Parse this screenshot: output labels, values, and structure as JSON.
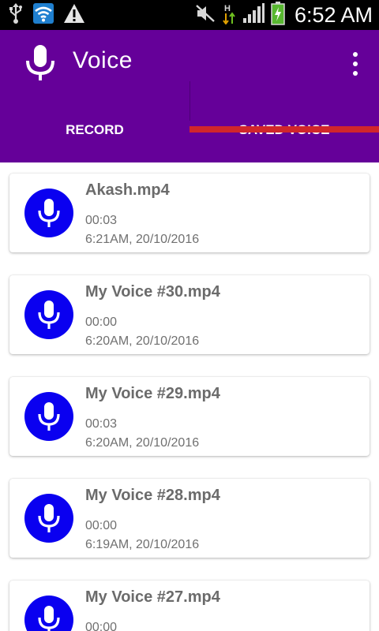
{
  "status_bar": {
    "time": "6:52 AM",
    "icons": [
      "usb-icon",
      "wifi-icon",
      "warning-icon",
      "mute-icon",
      "hsdpa-data-icon",
      "signal-icon",
      "battery-charging-icon"
    ]
  },
  "app_bar": {
    "title": "Voice",
    "icon": "microphone-icon",
    "menu_icon": "more-vert-icon",
    "color": "#650099"
  },
  "tabs": [
    {
      "label": "RECORD",
      "active": false
    },
    {
      "label": "SAVED VOICE",
      "active": true
    }
  ],
  "tab_indicator_color": "#d1262b",
  "recordings": [
    {
      "name": "Akash.mp4",
      "duration": "00:03",
      "date": "6:21AM, 20/10/2016"
    },
    {
      "name": "My Voice #30.mp4",
      "duration": "00:00",
      "date": "6:20AM, 20/10/2016"
    },
    {
      "name": "My Voice #29.mp4",
      "duration": "00:03",
      "date": "6:20AM, 20/10/2016"
    },
    {
      "name": "My Voice #28.mp4",
      "duration": "00:00",
      "date": "6:19AM, 20/10/2016"
    },
    {
      "name": "My Voice #27.mp4",
      "duration": "00:00",
      "date": ""
    }
  ],
  "avatar_color": "#0a00f0"
}
